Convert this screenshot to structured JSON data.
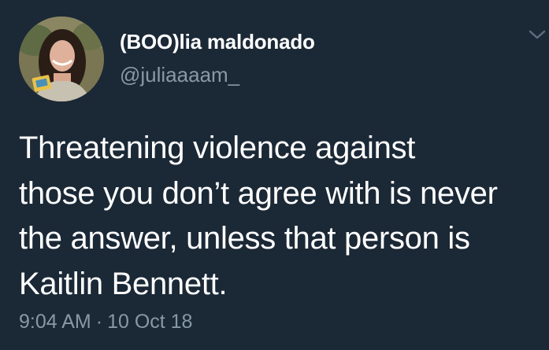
{
  "tweet": {
    "display_name": "(BOO)lia maldonado",
    "handle": "@juliaaaam_",
    "text": "Threatening violence against\nthose you don’t agree with is never\nthe answer, unless that person is\nKaitlin Bennett.",
    "time": "9:04 AM",
    "separator": "·",
    "date": "10 Oct 18"
  },
  "icons": {
    "menu": "chevron-down-icon",
    "avatar": "profile-photo"
  },
  "colors": {
    "background": "#1b2836",
    "primary_text": "#ffffff",
    "secondary_text": "#8899a6"
  }
}
